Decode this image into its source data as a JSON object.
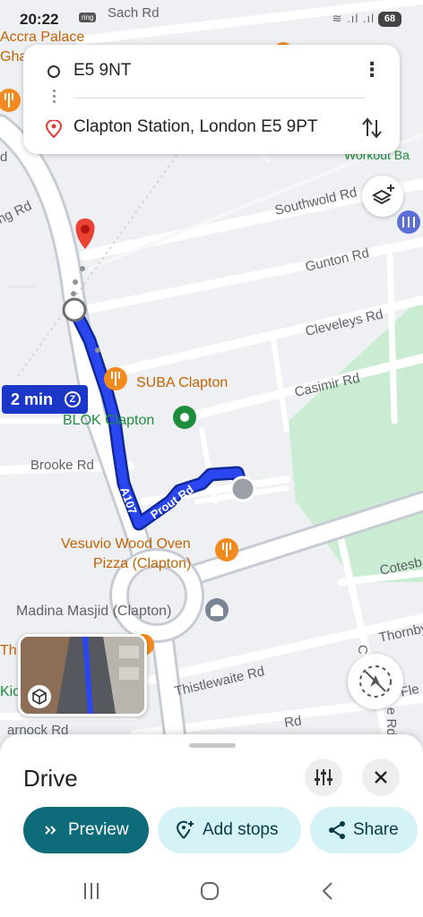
{
  "status_bar": {
    "time": "20:22",
    "notif": "ring",
    "battery": "68"
  },
  "route_card": {
    "origin": "E5 9NT",
    "destination": "Clapton Station, London E5 9PT"
  },
  "map": {
    "streets": {
      "sach_rd": "Sach Rd",
      "southwold_rd": "Southwold Rd",
      "gunton_rd": "Gunton Rd",
      "cleveleys_rd": "Cleveleys Rd",
      "casimir_rd": "Casimir Rd",
      "brooke_rd": "Brooke Rd",
      "a107": "A107",
      "prout_rd": "Prout Rd",
      "cotesb": "Cotesb",
      "thornby": "Thornby",
      "thistlewaite_rd": "Thistlewaite Rd",
      "rd_bottom": "Rd",
      "fle": "Fle",
      "ng_rd": "ng Rd",
      "d_left": "d",
      "arnock_rd": "arnock Rd",
      "clapton_vertical": "C",
      "clapton_vertical2": "e Rd"
    },
    "places": {
      "accra_palace": "Accra Palace",
      "gha": "Gha",
      "workout": "Workout Ba",
      "suba": "SUBA Clapton",
      "blok": "BLOK Clapton",
      "vesuvio_1": "Vesuvio Wood Oven",
      "vesuvio_2": "Pizza (Clapton)",
      "madina": "Madina Masjid (Clapton)",
      "th": "Th",
      "kid": "Kid"
    },
    "eta": "2 min",
    "eta_icon": "Z"
  },
  "sheet": {
    "title": "Drive",
    "preview_label": "Preview",
    "add_stops_label": "Add stops",
    "share_label": "Share"
  },
  "colors": {
    "route": "#1a37c7",
    "primary_button": "#0e6b7a",
    "secondary_button": "#d5f2f7",
    "park": "#c8ebd0",
    "food_poi": "#f28b1f",
    "destination_pin": "#e53935"
  }
}
